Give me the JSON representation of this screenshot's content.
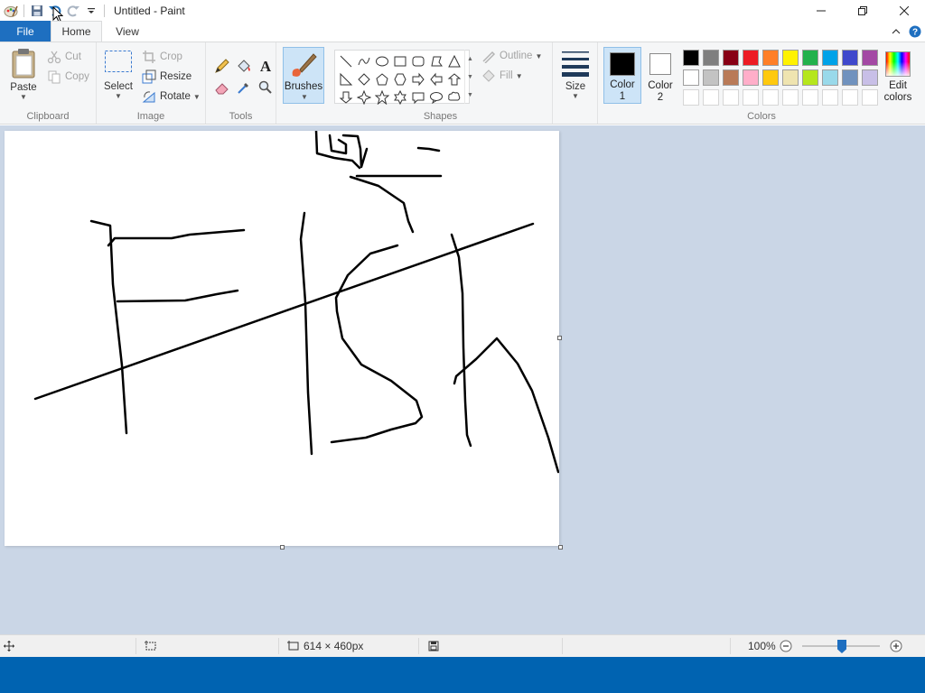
{
  "window": {
    "title": "Untitled - Paint",
    "controls": [
      "minimize",
      "restore",
      "close"
    ]
  },
  "quick_access": [
    "paint-app-icon",
    "save-icon",
    "undo-icon",
    "redo-icon",
    "customize-qat-icon"
  ],
  "tabs": {
    "file": "File",
    "home": "Home",
    "view": "View"
  },
  "ribbon": {
    "clipboard": {
      "label": "Clipboard",
      "paste": "Paste",
      "cut": "Cut",
      "copy": "Copy"
    },
    "image": {
      "label": "Image",
      "select": "Select",
      "crop": "Crop",
      "resize": "Resize",
      "rotate": "Rotate"
    },
    "tools": {
      "label": "Tools",
      "items": [
        "pencil-icon",
        "fill-icon",
        "text-icon",
        "eraser-icon",
        "color-picker-icon",
        "magnifier-icon"
      ]
    },
    "brushes": {
      "label": "Brushes"
    },
    "shapes": {
      "label": "Shapes",
      "outline": "Outline",
      "fill": "Fill"
    },
    "size": {
      "label": "Size"
    },
    "colors": {
      "label": "Colors",
      "color1_line1": "Color",
      "color1_line2": "1",
      "color2_line1": "Color",
      "color2_line2": "2",
      "edit_line1": "Edit",
      "edit_line2": "colors",
      "color1_value": "#000000",
      "color2_value": "#ffffff",
      "palette_row1": [
        "#000000",
        "#7f7f7f",
        "#880015",
        "#ed1c24",
        "#ff7f27",
        "#fff200",
        "#22b14c",
        "#00a2e8",
        "#3f48cc",
        "#a349a4"
      ],
      "palette_row2": [
        "#ffffff",
        "#c3c3c3",
        "#b97a57",
        "#ffaec9",
        "#ffc90e",
        "#efe4b0",
        "#b5e61d",
        "#99d9ea",
        "#7092be",
        "#c8bfe7"
      ],
      "palette_row3_empty": 10
    }
  },
  "status": {
    "canvas_size": "614 × 460px",
    "zoom": "100%"
  }
}
